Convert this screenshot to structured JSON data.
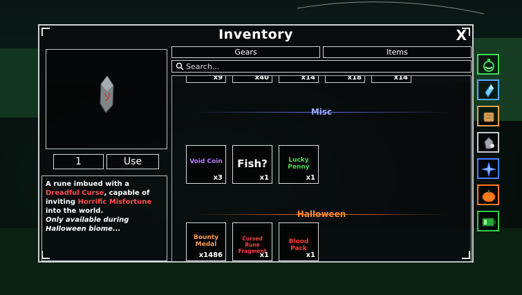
{
  "window": {
    "title": "Inventory",
    "close_label": "X"
  },
  "tabs": [
    {
      "label": "Gears"
    },
    {
      "label": "Items"
    }
  ],
  "search": {
    "placeholder": "Search..."
  },
  "preview": {
    "quantity": "1",
    "use_label": "Use"
  },
  "description": {
    "t1": "A rune imbued with a ",
    "t2": "Dreadful Curse",
    "t3": ", capable of inviting ",
    "t4": "Horrific Misfortune",
    "t5": " into the world.",
    "t6": "Only available during Halloween biome..."
  },
  "top_row_counts": [
    "x9",
    "x40",
    "x14",
    "x18",
    "x14"
  ],
  "sections": [
    {
      "title": "Misc",
      "color": "#9aa8ff",
      "items": [
        {
          "name": "Void Coin",
          "count": "x3",
          "color": "#b77cff"
        },
        {
          "name": "Fish?",
          "count": "x1",
          "color": "#ffffff"
        },
        {
          "name": "Lucky Penny",
          "count": "x1",
          "color": "#55d65b"
        }
      ]
    },
    {
      "title": "Halloween",
      "color": "#ff8a2a",
      "items": [
        {
          "name": "Bounty Medal",
          "count": "x1486",
          "color": "#ff9a4a"
        },
        {
          "name": "Cursed Rune Fragment",
          "count": "x1",
          "color": "#ff4040"
        },
        {
          "name": "Blood Pack",
          "count": "x1",
          "color": "#ff3a3a"
        }
      ]
    }
  ],
  "side_menu": [
    {
      "icon": "potion-icon",
      "color": "#3fd95a"
    },
    {
      "icon": "crystal-icon",
      "color": "#5aa9ff"
    },
    {
      "icon": "scroll-icon",
      "color": "#e3a34a"
    },
    {
      "icon": "rune-stone-icon",
      "color": "#c9ccd0"
    },
    {
      "icon": "star-icon",
      "color": "#4a7dff"
    },
    {
      "icon": "pumpkin-icon",
      "color": "#ff7a1a"
    },
    {
      "icon": "battery-icon",
      "color": "#33cc44"
    }
  ]
}
